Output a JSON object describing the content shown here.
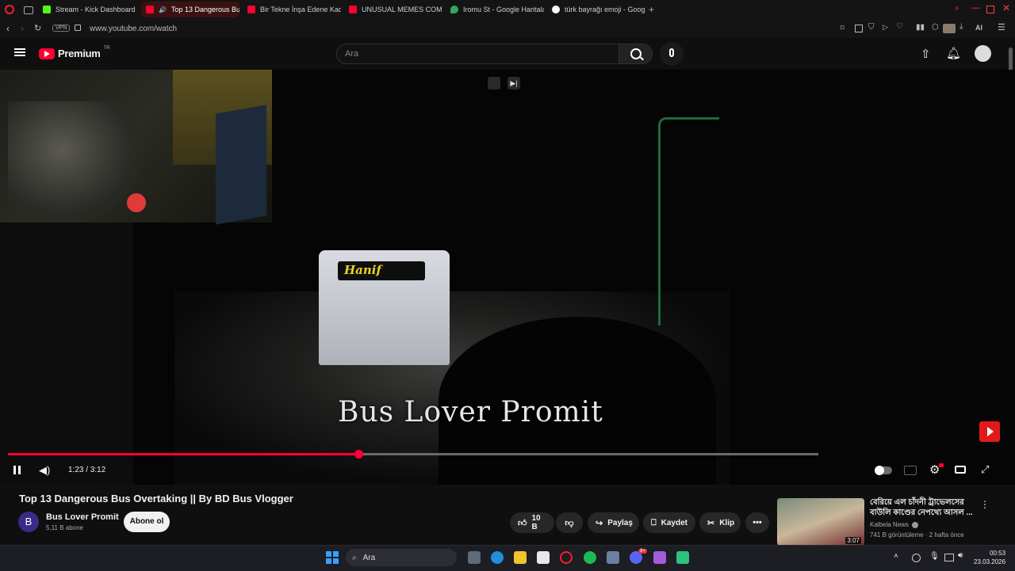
{
  "browser": {
    "tabs": [
      {
        "label": "Stream - Kick Dashboard",
        "color": "#53fc18"
      },
      {
        "label": "Top 13 Dangerous Bus",
        "color": "#ff0033",
        "active": true
      },
      {
        "label": "Bir Tekne İnşa Edene Kad",
        "color": "#ff0033"
      },
      {
        "label": "UNUSUAL MEMES COMP",
        "color": "#ff0033"
      },
      {
        "label": "Iromu St - Google Haritala",
        "color": "#34a853"
      },
      {
        "label": "türk bayrağı emoji - Googl",
        "color": "#ffffff"
      }
    ],
    "vpn": "VPN",
    "url": "www.youtube.com/watch",
    "ai_label": "AI"
  },
  "youtube": {
    "logo_text": "Premium",
    "region": "TR",
    "search_placeholder": "Ara"
  },
  "video": {
    "overlay_text": "Bus Lover Promit",
    "bus_sign": "Hanif",
    "current_time": "1:23",
    "duration": "3:12",
    "time_display": "1:23 / 3:12",
    "progress": 0.4323
  },
  "details": {
    "title": "Top 13 Dangerous Bus Overtaking || By BD Bus Vlogger",
    "channel_initial": "B",
    "channel_name": "Bus Lover Promit",
    "subscribers": "5,11 B abone",
    "subscribe_label": "Abone ol",
    "likes": "10 B",
    "share_label": "Paylaş",
    "save_label": "Kaydet",
    "clip_label": "Klip"
  },
  "recommended": {
    "title": "বেরিয়ে এল চাঁদনী ট্রাভেলসের বাউলি কাণ্ডের নেপথ্যে আসল ...",
    "channel": "Kalbela News",
    "meta": "741 B görüntüleme · 2 hafta önce",
    "duration": "3:07"
  },
  "taskbar": {
    "search_placeholder": "Ara",
    "time": "00:53",
    "date": "23.03.2026",
    "discord_badge": "9+"
  }
}
